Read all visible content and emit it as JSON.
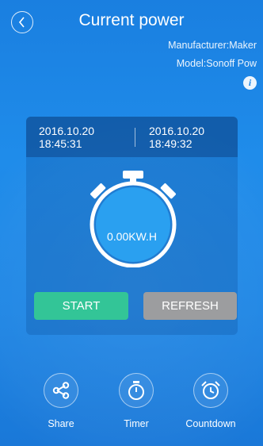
{
  "header": {
    "title": "Current power",
    "manufacturer": "Manufacturer:Maker",
    "model": "Model:Sonoff Pow",
    "info_symbol": "i"
  },
  "panel": {
    "start_time": "2016.10.20 18:45:31",
    "end_time": "2016.10.20 18:49:32",
    "reading": "0.00KW.H",
    "start_button": "START",
    "refresh_button": "REFRESH"
  },
  "actions": [
    {
      "label": "Share",
      "icon": "share-icon"
    },
    {
      "label": "Timer",
      "icon": "stopwatch-icon"
    },
    {
      "label": "Countdown",
      "icon": "alarm-clock-icon"
    }
  ],
  "colors": {
    "background": "#1d85e4",
    "start_button": "#33c597",
    "refresh_button": "#9c9d9f"
  }
}
